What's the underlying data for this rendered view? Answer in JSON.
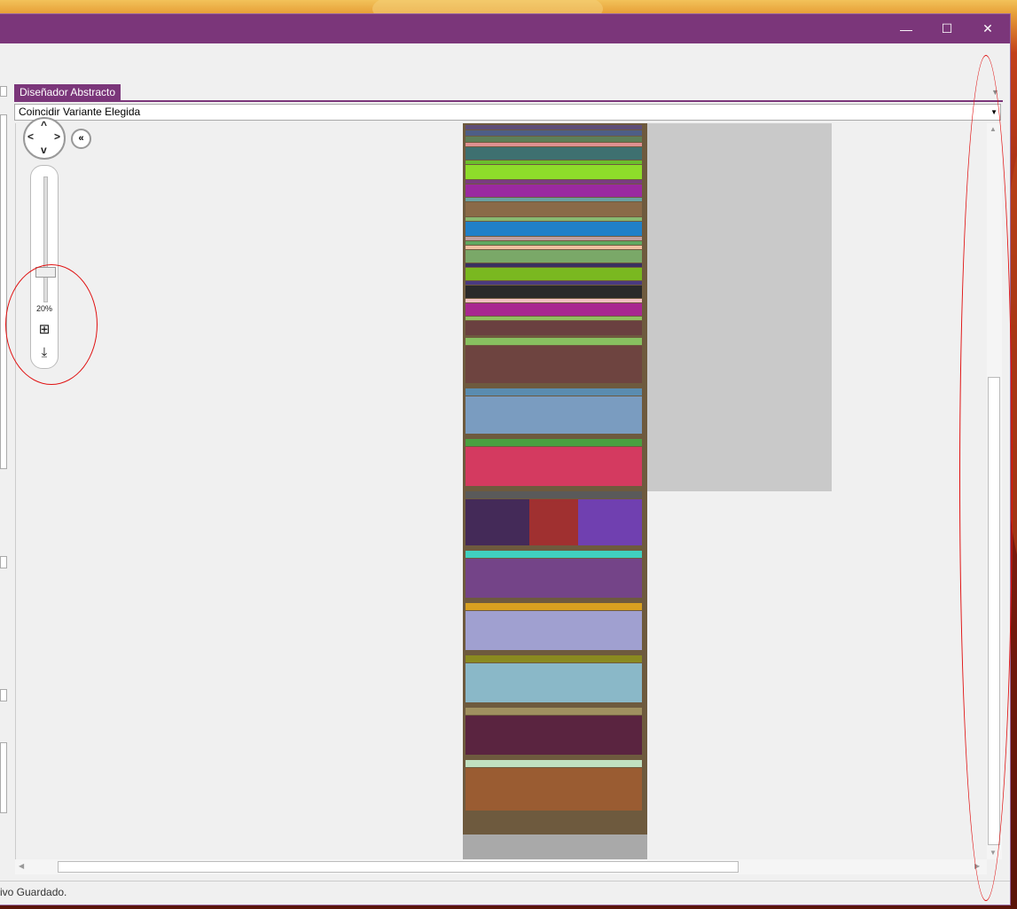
{
  "window": {
    "minimize": "—",
    "maximize": "☐",
    "close": "✕"
  },
  "tab": {
    "label": "Diseñador Abstracto"
  },
  "combo": {
    "value": "Coincidir Variante Elegida"
  },
  "zoom": {
    "level": "20%"
  },
  "status": {
    "text": "ivo Guardado."
  },
  "icons": {
    "nav": "pan-arrows-icon",
    "collapse": "double-chevron-left-icon",
    "fit": "fit-to-window-icon",
    "export": "export-icon"
  },
  "colors": {
    "accent": "#7b367a",
    "annotation": "#e01010"
  },
  "bands": [
    {
      "c": "#5e4e78",
      "h": 5
    },
    {
      "c": "#4e5e86",
      "h": 6
    },
    {
      "c": "#5e7e58",
      "h": 6
    },
    {
      "c": "#e09090",
      "h": 4
    },
    {
      "c": "#3e7070",
      "h": 14
    },
    {
      "c": "#6bbf2c",
      "h": 4
    },
    {
      "c": "#8edc2a",
      "h": 16
    },
    {
      "c": "#7a3c80",
      "h": 4
    },
    {
      "c": "#9a2aa0",
      "h": 14
    },
    {
      "c": "#6aa0a0",
      "h": 4
    },
    {
      "c": "#8a6a48",
      "h": 16
    },
    {
      "c": "#88b870",
      "h": 4
    },
    {
      "c": "#2080c8",
      "h": 16
    },
    {
      "c": "#c0a0a0",
      "h": 4
    },
    {
      "c": "#60a860",
      "h": 4
    },
    {
      "c": "#f0c0a0",
      "h": 4
    },
    {
      "c": "#7aa868",
      "h": 14
    },
    {
      "c": "#3a3060",
      "h": 4
    },
    {
      "c": "#7ab820",
      "h": 14
    },
    {
      "c": "#4a3a80",
      "h": 4
    },
    {
      "c": "#2a2a2a",
      "h": 14
    },
    {
      "c": "#f0c0c0",
      "h": 4
    },
    {
      "c": "#a82890",
      "h": 14
    },
    {
      "c": "#90c060",
      "h": 4
    },
    {
      "c": "#6a4040",
      "h": 16
    }
  ],
  "blocks": [
    {
      "header": "#88c060",
      "body": "#6e4440",
      "h": 42
    },
    {
      "header": "#5a8cb0",
      "body": "#7a9cc0",
      "h": 42
    },
    {
      "header": "#4aa040",
      "body": "#d43a60",
      "h": 44
    },
    {
      "header": "#5a5a5a",
      "body": "#402a58",
      "h": 52
    },
    {
      "header": "#40d0c0",
      "body": "#744488",
      "h": 44
    },
    {
      "header": "#d8a020",
      "body": "#a0a0d0",
      "h": 44
    },
    {
      "header": "#8a8a20",
      "body": "#8ab8c8",
      "h": 44
    },
    {
      "header": "#a09060",
      "body": "#5a2440",
      "h": 44
    },
    {
      "header": "#c0e0c0",
      "body": "#9a5c32",
      "h": 48
    }
  ]
}
